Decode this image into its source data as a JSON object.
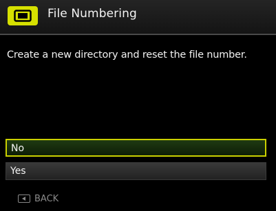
{
  "header": {
    "title": "File Numbering",
    "tab_icon": "setup-card-icon",
    "accent_color": "#d6e000"
  },
  "message": "Create a new directory and  reset the file number.",
  "options": [
    {
      "label": "No",
      "selected": true
    },
    {
      "label": "Yes",
      "selected": false
    }
  ],
  "footer": {
    "back_label": "BACK",
    "back_icon": "back-button-icon"
  }
}
